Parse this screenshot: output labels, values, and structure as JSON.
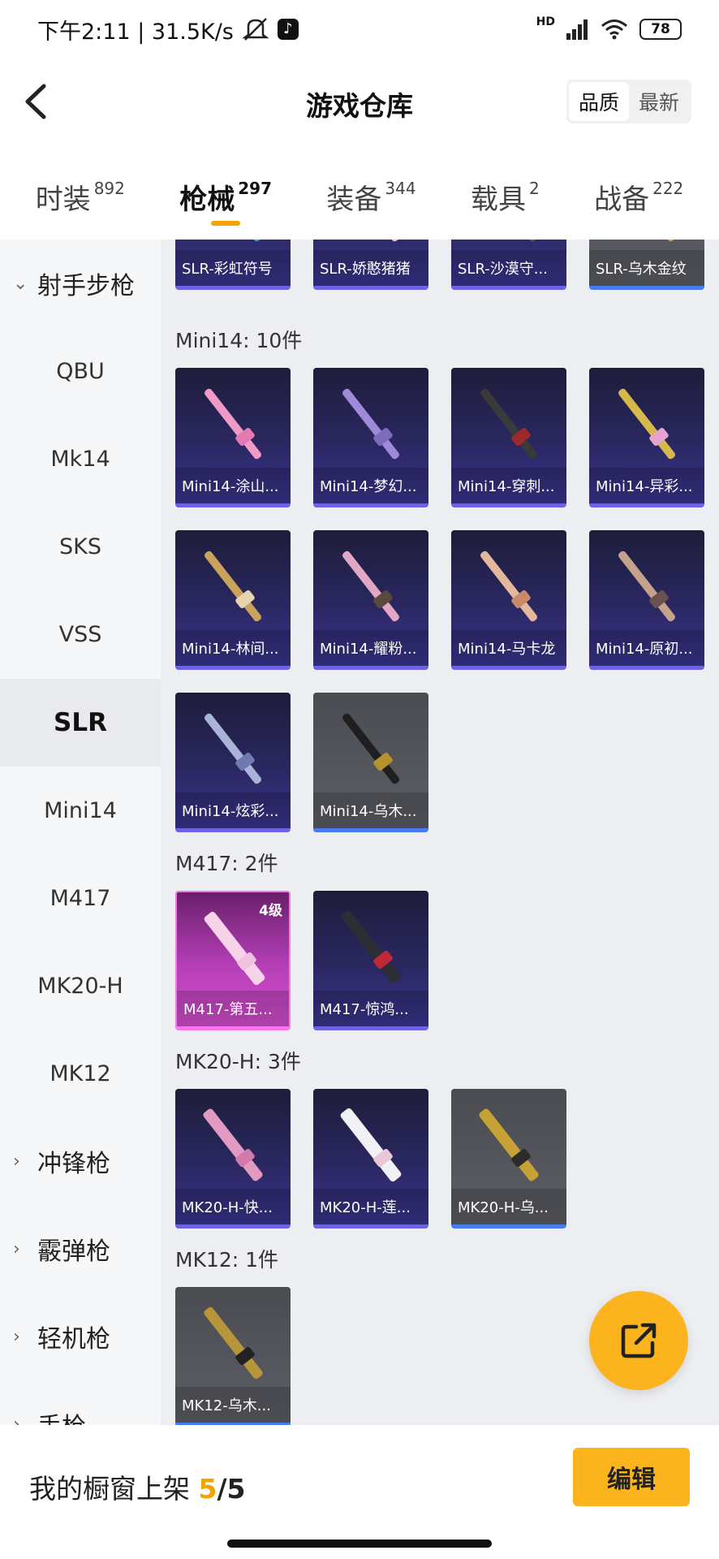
{
  "status_bar": {
    "time_speed": "下午2:11 | 31.5K/s",
    "network": "HD",
    "battery": "78",
    "icons": [
      "mute-icon",
      "tiktok-icon",
      "signal-icon",
      "wifi-icon",
      "battery-icon"
    ]
  },
  "header": {
    "title": "游戏仓库",
    "sort": [
      "品质",
      "最新"
    ],
    "sort_active": "品质"
  },
  "tabs": [
    {
      "label": "时装",
      "count": "892"
    },
    {
      "label": "枪械",
      "count": "297",
      "active": true
    },
    {
      "label": "装备",
      "count": "344"
    },
    {
      "label": "载具",
      "count": "2"
    },
    {
      "label": "战备",
      "count": "222"
    }
  ],
  "sidebar": {
    "group_open": "射手步枪",
    "items": [
      "QBU",
      "Mk14",
      "SKS",
      "VSS",
      "SLR",
      "Mini14",
      "M417",
      "MK20-H",
      "MK12"
    ],
    "active": "SLR",
    "groups_closed": [
      "冲锋枪",
      "霰弹枪",
      "轻机枪",
      "手枪"
    ]
  },
  "sections": {
    "slr_top_row": [
      "SLR-彩虹符号",
      "SLR-娇憨猪猪",
      "SLR-沙漠守...",
      "SLR-乌木金纹"
    ],
    "mini14": {
      "title": "Mini14: 10件",
      "items": [
        "Mini14-涂山...",
        "Mini14-梦幻...",
        "Mini14-穿刺...",
        "Mini14-异彩...",
        "Mini14-林间...",
        "Mini14-耀粉...",
        "Mini14-马卡龙",
        "Mini14-原初...",
        "Mini14-炫彩...",
        "Mini14-乌木..."
      ]
    },
    "m417": {
      "title": "M417: 2件",
      "items": [
        "M417-第五...",
        "M417-惊鸿..."
      ],
      "level_badge": "4级"
    },
    "mk20h": {
      "title": "MK20-H: 3件",
      "items": [
        "MK20-H-快...",
        "MK20-H-莲...",
        "MK20-H-乌..."
      ]
    },
    "mk12": {
      "title": "MK12: 1件",
      "items": [
        "MK12-乌木..."
      ]
    }
  },
  "bottom": {
    "label": "我的橱窗上架",
    "current": "5",
    "total": "/5",
    "edit": "编辑"
  },
  "colors": {
    "accent": "#fbb41d",
    "purple_card": "#2a2760",
    "pink_card": "#c13fc0"
  }
}
